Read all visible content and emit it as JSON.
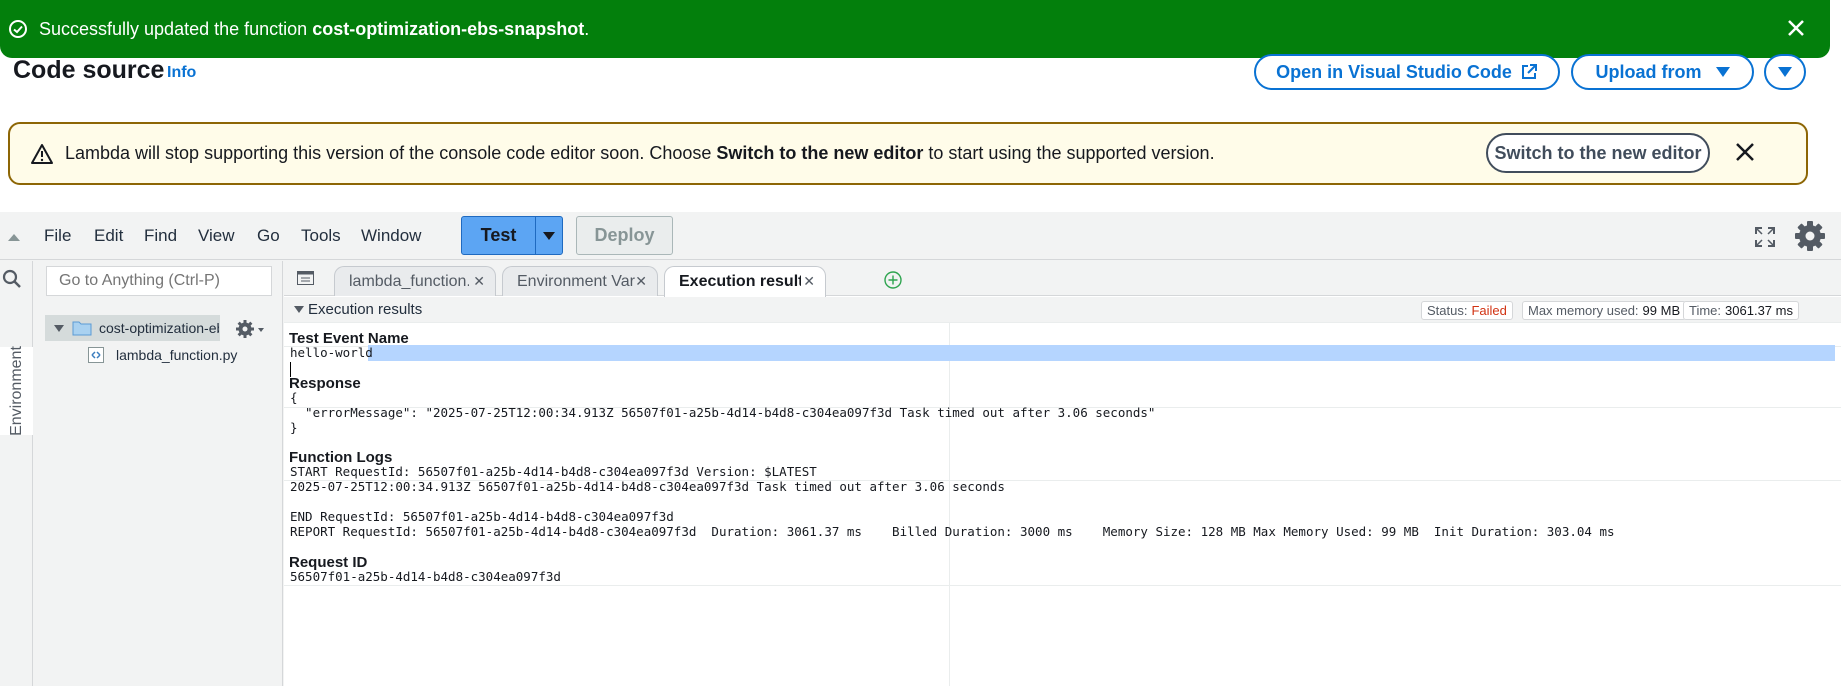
{
  "flash": {
    "prefix": "Successfully updated the function ",
    "function_name": "cost-optimization-ebs-snapshot",
    "suffix": ".",
    "color": "#037f0c"
  },
  "header": {
    "title": "Code source",
    "info": "Info",
    "open_vscode": "Open in Visual Studio Code",
    "upload_from": "Upload from"
  },
  "warning": {
    "text_before": "Lambda will stop supporting this version of the console code editor soon. Choose ",
    "text_bold": "Switch to the new editor",
    "text_after": " to start using the supported version.",
    "button": "Switch to the new editor"
  },
  "menu": [
    "File",
    "Edit",
    "Find",
    "View",
    "Go",
    "Tools",
    "Window"
  ],
  "toolbar": {
    "test": "Test",
    "deploy": "Deploy"
  },
  "sidebar": {
    "environment_tab": "Environment",
    "goto_placeholder": "Go to Anything (Ctrl-P)",
    "folder": "cost-optimization-ebs-snapshot",
    "file": "lambda_function.py"
  },
  "tabs": [
    {
      "label": "lambda_function.py",
      "active": false
    },
    {
      "label": "Environment Variables",
      "active": false
    },
    {
      "label": "Execution results",
      "active": true
    }
  ],
  "results": {
    "header": "Execution results",
    "status_label": "Status:",
    "status_value": "Failed",
    "memory_label": "Max memory used:",
    "memory_value": "99 MB",
    "time_label": "Time:",
    "time_value": "3061.37 ms",
    "test_event_heading": "Test Event Name",
    "test_event_value": "hello-world",
    "response_heading": "Response",
    "response_lines": [
      "{",
      "  \"errorMessage\": \"2025-07-25T12:00:34.913Z 56507f01-a25b-4d14-b4d8-c304ea097f3d Task timed out after 3.06 seconds\"",
      "}"
    ],
    "logs_heading": "Function Logs",
    "log_lines": [
      "START RequestId: 56507f01-a25b-4d14-b4d8-c304ea097f3d Version: $LATEST",
      "2025-07-25T12:00:34.913Z 56507f01-a25b-4d14-b4d8-c304ea097f3d Task timed out after 3.06 seconds",
      "",
      "END RequestId: 56507f01-a25b-4d14-b4d8-c304ea097f3d",
      "REPORT RequestId: 56507f01-a25b-4d14-b4d8-c304ea097f3d  Duration: 3061.37 ms    Billed Duration: 3000 ms    Memory Size: 128 MB Max Memory Used: 99 MB  Init Duration: 303.04 ms"
    ],
    "request_heading": "Request ID",
    "request_id": "56507f01-a25b-4d14-b4d8-c304ea097f3d"
  }
}
